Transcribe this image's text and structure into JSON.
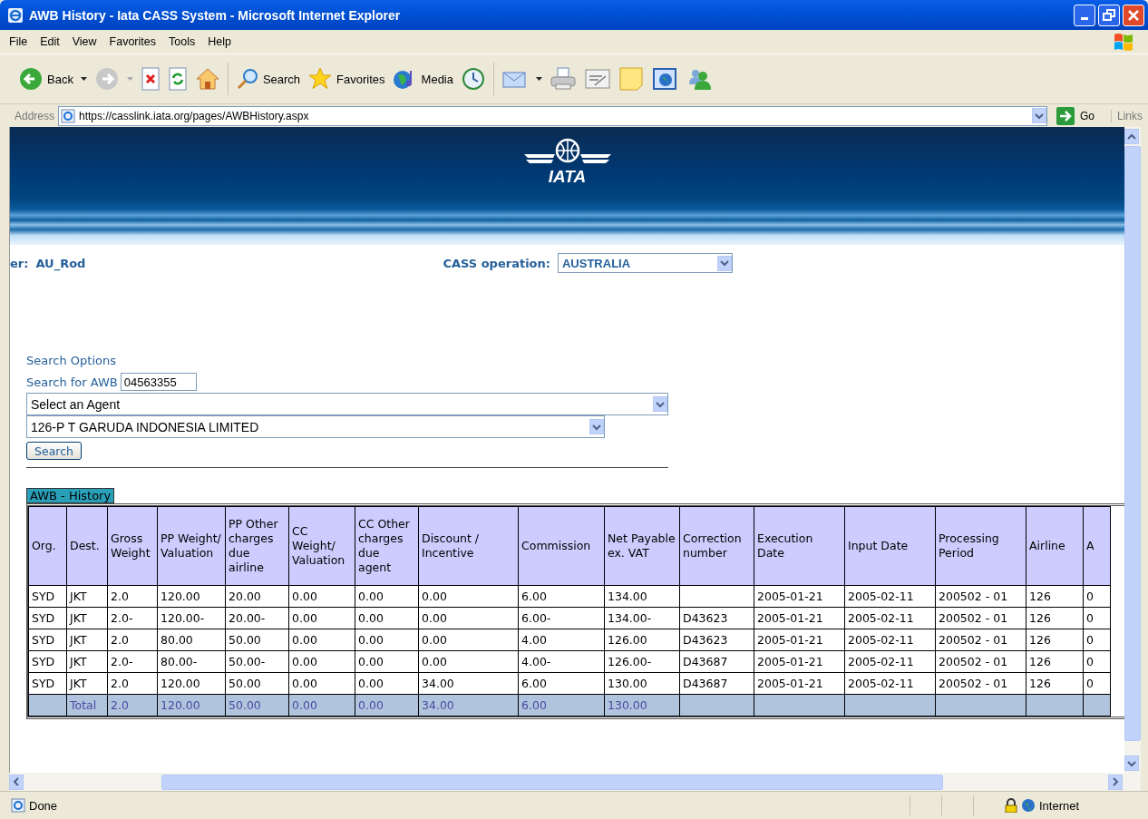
{
  "window": {
    "title": "AWB History - Iata CASS System - Microsoft Internet Explorer"
  },
  "menu": [
    "File",
    "Edit",
    "View",
    "Favorites",
    "Tools",
    "Help"
  ],
  "toolbar": {
    "back": "Back",
    "search": "Search",
    "favorites": "Favorites",
    "media": "Media"
  },
  "address": {
    "label": "Address",
    "url": "https://casslink.iata.org/pages/AWBHistory.aspx",
    "go": "Go",
    "links": "Links"
  },
  "banner": {
    "logo_text": "IATA"
  },
  "user": {
    "label": "er:",
    "value": "AU_Rod"
  },
  "cass_operation": {
    "label": "CASS operation:",
    "value": "AUSTRALIA"
  },
  "search": {
    "title": "Search Options",
    "awb_label": "Search for AWB",
    "awb_value": "04563355",
    "agent": "Select an Agent",
    "airline": "126-P T GARUDA INDONESIA LIMITED",
    "button": "Search"
  },
  "history": {
    "tab": "AWB - History",
    "columns": [
      "Org.",
      "Dest.",
      "Gross Weight",
      "PP Weight/ Valuation",
      "PP Other charges due airline",
      "CC Weight/ Valuation",
      "CC Other charges due agent",
      "Discount / Incentive",
      "Commission",
      "Net Payable ex. VAT",
      "Correction number",
      "Execution Date",
      "Input Date",
      "Processing Period",
      "Airline",
      "A"
    ],
    "rows": [
      [
        "SYD",
        "JKT",
        "2.0",
        "120.00",
        "20.00",
        "0.00",
        "0.00",
        "0.00",
        "6.00",
        "134.00",
        null,
        "2005-01-21",
        "2005-02-11",
        "200502 - 01",
        "126",
        "0"
      ],
      [
        "SYD",
        "JKT",
        "2.0-",
        "120.00-",
        "20.00-",
        "0.00",
        "0.00",
        "0.00",
        "6.00-",
        "134.00-",
        "D43623",
        "2005-01-21",
        "2005-02-11",
        "200502 - 01",
        "126",
        "0"
      ],
      [
        "SYD",
        "JKT",
        "2.0",
        "80.00",
        "50.00",
        "0.00",
        "0.00",
        "0.00",
        "4.00",
        "126.00",
        "D43623",
        "2005-01-21",
        "2005-02-11",
        "200502 - 01",
        "126",
        "0"
      ],
      [
        "SYD",
        "JKT",
        "2.0-",
        "80.00-",
        "50.00-",
        "0.00",
        "0.00",
        "0.00",
        "4.00-",
        "126.00-",
        "D43687",
        "2005-01-21",
        "2005-02-11",
        "200502 - 01",
        "126",
        "0"
      ],
      [
        "SYD",
        "JKT",
        "2.0",
        "120.00",
        "50.00",
        "0.00",
        "0.00",
        "34.00",
        "6.00",
        "130.00",
        "D43687",
        "2005-01-21",
        "2005-02-11",
        "200502 - 01",
        "126",
        "0"
      ]
    ],
    "total": {
      "label": "Total",
      "values": [
        "2.0",
        "120.00",
        "50.00",
        "0.00",
        "0.00",
        "34.00",
        "6.00",
        "130.00"
      ]
    }
  },
  "status": {
    "text": "Done",
    "zone": "Internet"
  }
}
